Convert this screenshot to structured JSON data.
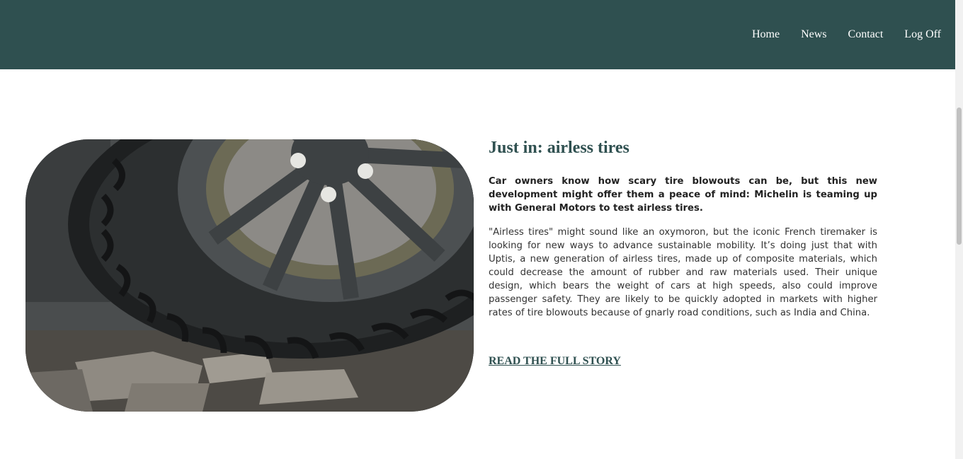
{
  "nav": {
    "items": [
      {
        "label": "Home"
      },
      {
        "label": "News"
      },
      {
        "label": "Contact"
      },
      {
        "label": "Log Off"
      }
    ]
  },
  "article": {
    "title": "Just in: airless tires",
    "lead": "Car owners know how scary tire blowouts can be, but this new development might offer them a peace of mind: Michelin is teaming up with General Motors to test airless tires.",
    "body": "\"Airless tires\" might sound like an oxymoron, but the iconic French tiremaker is looking for new ways to advance sustainable mobility. It’s doing just that with Uptis, a new generation of airless tires, made up of composite materials, which could decrease the amount of rubber and raw materials used. Their unique design, which bears the weight of cars at high speeds, also could improve passenger safety. They are likely to be quickly adopted in markets with higher rates of tire blowouts because of gnarly road conditions, such as India and China.",
    "read_more": "READ THE FULL STORY"
  },
  "colors": {
    "header_bg": "#2f5050",
    "accent": "#2f5050",
    "page_bg": "#ffffff"
  }
}
